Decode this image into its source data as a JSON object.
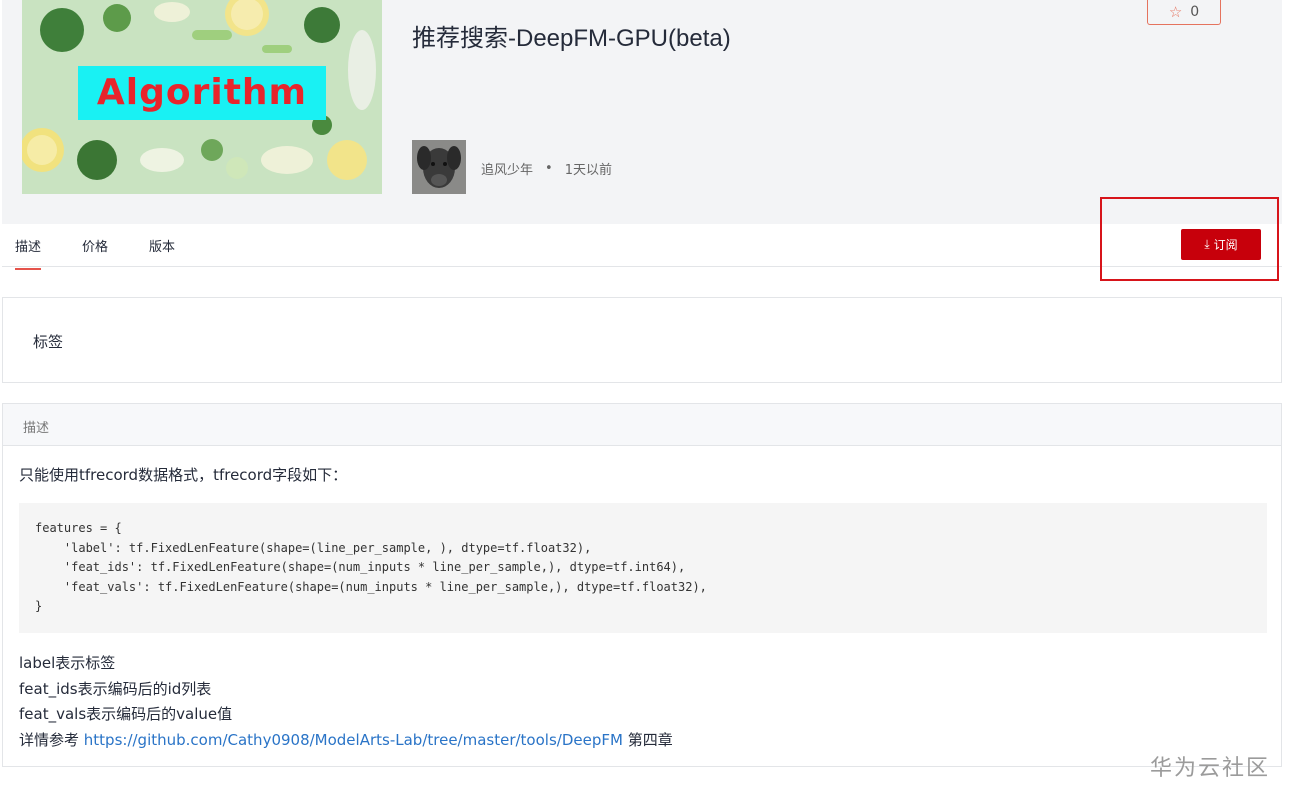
{
  "header": {
    "cover_text": "Algorithm",
    "title": "推荐搜索-DeepFM-GPU(beta)",
    "favorite_count": "0",
    "author": "追风少年",
    "separator": "•",
    "updated": "1天以前"
  },
  "tabs": [
    {
      "label": "描述",
      "active": true
    },
    {
      "label": "价格",
      "active": false
    },
    {
      "label": "版本",
      "active": false
    }
  ],
  "subscribe_label": "订阅",
  "tags_label": "标签",
  "description": {
    "heading": "描述",
    "intro": "只能使用tfrecord数据格式，tfrecord字段如下：",
    "code_lines": [
      "features = {",
      "    'label': tf.FixedLenFeature(shape=(line_per_sample, ), dtype=tf.float32),",
      "    'feat_ids': tf.FixedLenFeature(shape=(num_inputs * line_per_sample,), dtype=tf.int64),",
      "    'feat_vals': tf.FixedLenFeature(shape=(num_inputs * line_per_sample,), dtype=tf.float32),",
      "}"
    ],
    "note_1": "label表示标签",
    "note_2": "feat_ids表示编码后的id列表",
    "note_3": "feat_vals表示编码后的value值",
    "ref_prefix": "详情参考 ",
    "ref_link": "https://github.com/Cathy0908/ModelArts-Lab/tree/master/tools/DeepFM",
    "ref_suffix": " 第四章"
  },
  "watermark": "华为云社区",
  "colors": {
    "accent_red": "#c7000b",
    "highlight_frame": "#d7141a",
    "link": "#2a74c7",
    "cover_label_bg": "#19f1f3"
  }
}
